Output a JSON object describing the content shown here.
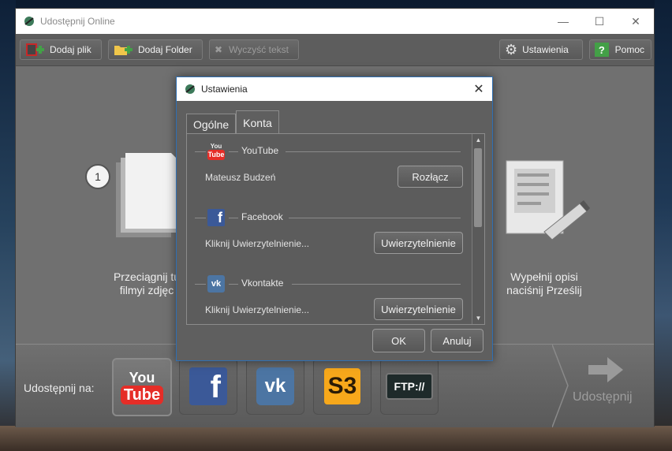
{
  "window": {
    "title": "Udostępnij Online"
  },
  "toolbar": {
    "add_file": "Dodaj plik",
    "add_folder": "Dodaj Folder",
    "clear_text": "Wyczyść tekst",
    "settings": "Ustawienia",
    "help": "Pomoc"
  },
  "steps": {
    "step1_number": "1",
    "step1_line1": "Przeciągnij tu",
    "step1_line2": "filmyi zdjęc",
    "step3_line1": "Wypełnij opisi",
    "step3_line2": "naciśnij Prześlij"
  },
  "share": {
    "label": "Udostępnij na:",
    "services": [
      "YouTube",
      "Facebook",
      "Vkontakte",
      "S3",
      "FTP://"
    ],
    "youtube_icon_line1": "You",
    "youtube_icon_line2": "Tube",
    "s3_icon_text": "S3",
    "ftp_icon_text": "FTP://",
    "share_button": "Udostępnij"
  },
  "dialog": {
    "title": "Ustawienia",
    "tabs": [
      "Ogólne",
      "Konta"
    ],
    "active_tab": "Konta",
    "accounts": [
      {
        "service": "YouTube",
        "status": "Mateusz Budzeń",
        "action": "Rozłącz"
      },
      {
        "service": "Facebook",
        "status": "Kliknij Uwierzytelnienie...",
        "action": "Uwierzytelnienie"
      },
      {
        "service": "Vkontakte",
        "status": "Kliknij Uwierzytelnienie...",
        "action": "Uwierzytelnienie"
      }
    ],
    "ok": "OK",
    "cancel": "Anuluj"
  },
  "colors": {
    "youtube_red": "#e52d27",
    "facebook_blue": "#3b5998",
    "vk_blue": "#4c75a3",
    "s3_orange": "#f7a81b",
    "help_green": "#43a047",
    "dialog_border": "#2f6fb3"
  }
}
